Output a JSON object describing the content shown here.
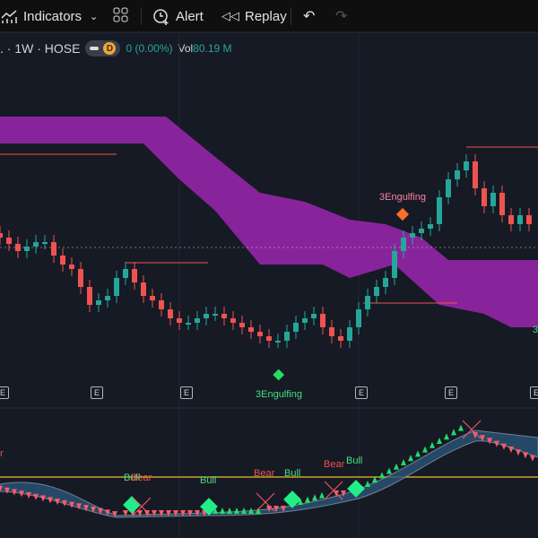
{
  "toolbar": {
    "indicators": "Indicators",
    "alert": "Alert",
    "replay": "Replay"
  },
  "legend": {
    "symbol": ". · 1W · HOSE",
    "interval_badge": "D",
    "change": "0 (0.00%)",
    "vol_label": "Vol",
    "vol_value": "80.19 M"
  },
  "earnings_marker": "E",
  "annotations": {
    "engulf_bear": "3Engulfing",
    "engulf_bull": "3Engulfing",
    "edge_label": "3"
  },
  "oscillator_labels": [
    {
      "text": "Bull",
      "color": "#4ade80"
    },
    {
      "text": "Bear",
      "color": "#ef5350"
    },
    {
      "text": "Bull",
      "color": "#4ade80"
    },
    {
      "text": "Bear",
      "color": "#ef5350"
    },
    {
      "text": "Bull",
      "color": "#4ade80"
    },
    {
      "text": "Bear",
      "color": "#ef5350"
    },
    {
      "text": "Bull",
      "color": "#4ade80"
    },
    {
      "text": "r",
      "color": "#ef5350"
    }
  ],
  "colors": {
    "up": "#26a69a",
    "down": "#ef5350",
    "cloud": "#9c27b0",
    "accent": "#f0a43c"
  },
  "candles_close": [
    23.5,
    22.8,
    22,
    22.5,
    23,
    23,
    21.5,
    20.5,
    20,
    18,
    16,
    16.5,
    17,
    19,
    20,
    18.5,
    17,
    16.5,
    15.5,
    14.5,
    14,
    14,
    14.5,
    15,
    15,
    14.5,
    14,
    13.5,
    13,
    12.5,
    12,
    12,
    13,
    14,
    14.5,
    15,
    13.5,
    12.5,
    12,
    13.5,
    15.5,
    17,
    18,
    19,
    22,
    23.5,
    24,
    24.5,
    25,
    28,
    30,
    31,
    32,
    29,
    27,
    28.5,
    26,
    25,
    26,
    25
  ]
}
